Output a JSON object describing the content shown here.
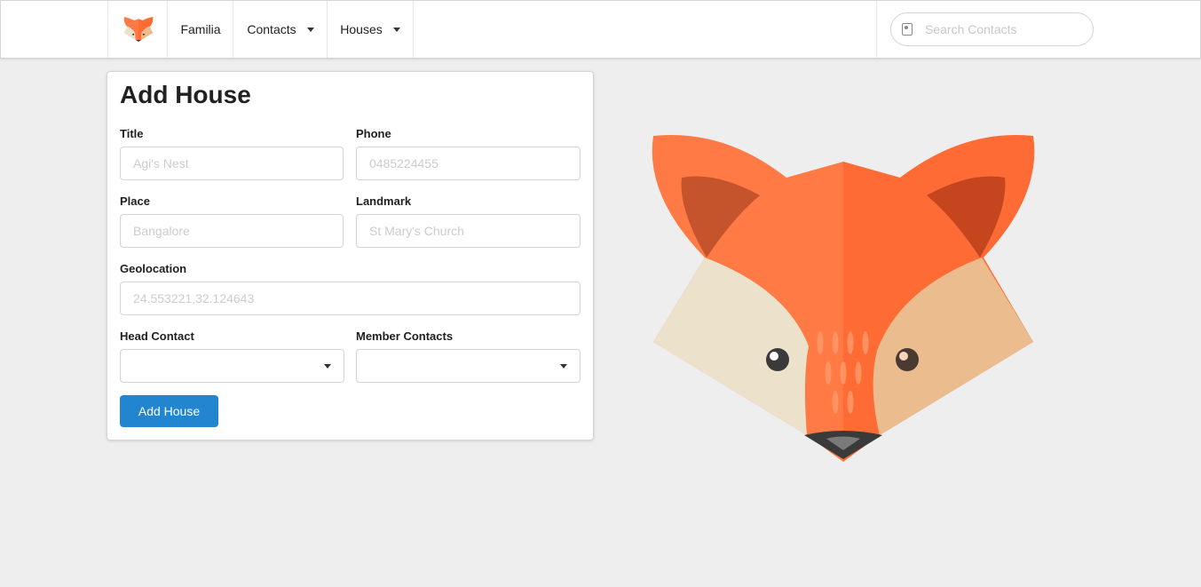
{
  "nav": {
    "logo_icon": "fox-logo-icon",
    "items": [
      {
        "label": "Familia"
      },
      {
        "label": "Contacts",
        "has_dropdown": true
      },
      {
        "label": "Houses",
        "has_dropdown": true
      }
    ],
    "search": {
      "placeholder": "Search Contacts",
      "icon": "contact-card-icon"
    }
  },
  "form": {
    "title": "Add House",
    "fields": {
      "title": {
        "label": "Title",
        "placeholder": "Agi's Nest",
        "value": ""
      },
      "phone": {
        "label": "Phone",
        "placeholder": "0485224455",
        "value": ""
      },
      "place": {
        "label": "Place",
        "placeholder": "Bangalore",
        "value": ""
      },
      "landmark": {
        "label": "Landmark",
        "placeholder": "St Mary's Church",
        "value": ""
      },
      "geolocation": {
        "label": "Geolocation",
        "placeholder": "24.553221,32.124643",
        "value": ""
      },
      "head_contact": {
        "label": "Head Contact",
        "value": ""
      },
      "member_contacts": {
        "label": "Member Contacts",
        "value": ""
      }
    },
    "submit_label": "Add House"
  },
  "colors": {
    "primary_button": "#2185d0",
    "fox_orange": "#ff6b35",
    "background": "#eeeeee"
  },
  "illustration": {
    "icon": "fox-face-illustration"
  }
}
